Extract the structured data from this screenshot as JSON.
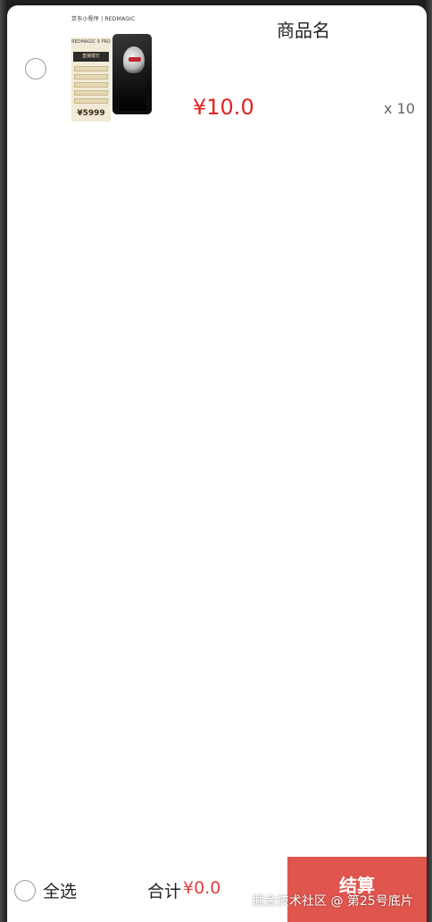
{
  "cart": {
    "items": [
      {
        "name": "商品名",
        "price": "¥10.0",
        "quantity": "x 10",
        "selected": false,
        "image": {
          "brand_text": "京东小程序 | REDMAGIC",
          "model_text": "REDMAGIC 9 PRO",
          "banner_text": "直接拨打",
          "price_text": "¥5999"
        }
      }
    ]
  },
  "footer": {
    "select_all_label": "全选",
    "total_label": "合计",
    "total_value": "¥0.0",
    "checkout_label": "结算"
  },
  "watermark": "掘金技术社区 @ 第25号底片",
  "colors": {
    "price": "#e02323",
    "checkout_bg": "#e0554e",
    "total": "#e04040"
  },
  "icons": {
    "item_select": "radio-circle-icon",
    "select_all": "radio-circle-icon"
  }
}
